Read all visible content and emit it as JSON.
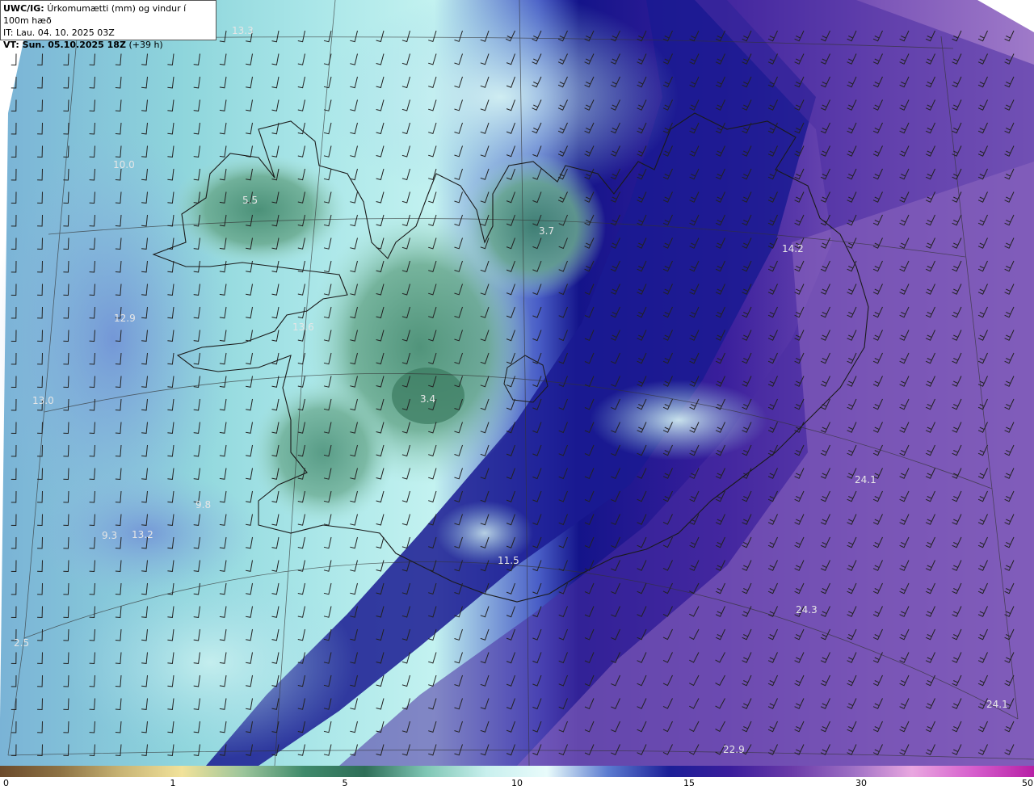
{
  "header": {
    "product": "UWC/IG:",
    "description": "Úrkomumætti (mm) og vindur í 100m hæð",
    "issue_time": "IT: Lau. 04. 10. 2025 03Z",
    "valid_prefix": "VT: Sun. 05.10.2025 18Z",
    "valid_offset": "(+39 h)"
  },
  "map_values": [
    "13.3",
    "10.0",
    "5.5",
    "3.7",
    "14.2",
    "12.9",
    "13.6",
    "13.0",
    "3.4",
    "9.8",
    "9.3",
    "13.2",
    "11.5",
    "24.1",
    "24.3",
    "2.5",
    "24.1",
    "22.9"
  ],
  "colorbar": {
    "ticks": [
      "0",
      "1",
      "5",
      "10",
      "15",
      "30",
      "50"
    ],
    "colors": [
      "#6b4a2b",
      "#8e7344",
      "#c9b575",
      "#f1e29a",
      "#9cc59b",
      "#3f8a6b",
      "#2e6e58",
      "#7fc6b4",
      "#c9f0ee",
      "#e8fbfb",
      "#5b7bd0",
      "#1c1f97",
      "#3a1d9c",
      "#6a3aa8",
      "#9d6fc4",
      "#e9a7e0",
      "#d65fcd",
      "#b71fa6"
    ]
  },
  "colors": {
    "land_green": "#5e9f86",
    "deep_blue": "#14148a",
    "purple": "#9a74c6",
    "light_cyan": "#bff0ee"
  }
}
